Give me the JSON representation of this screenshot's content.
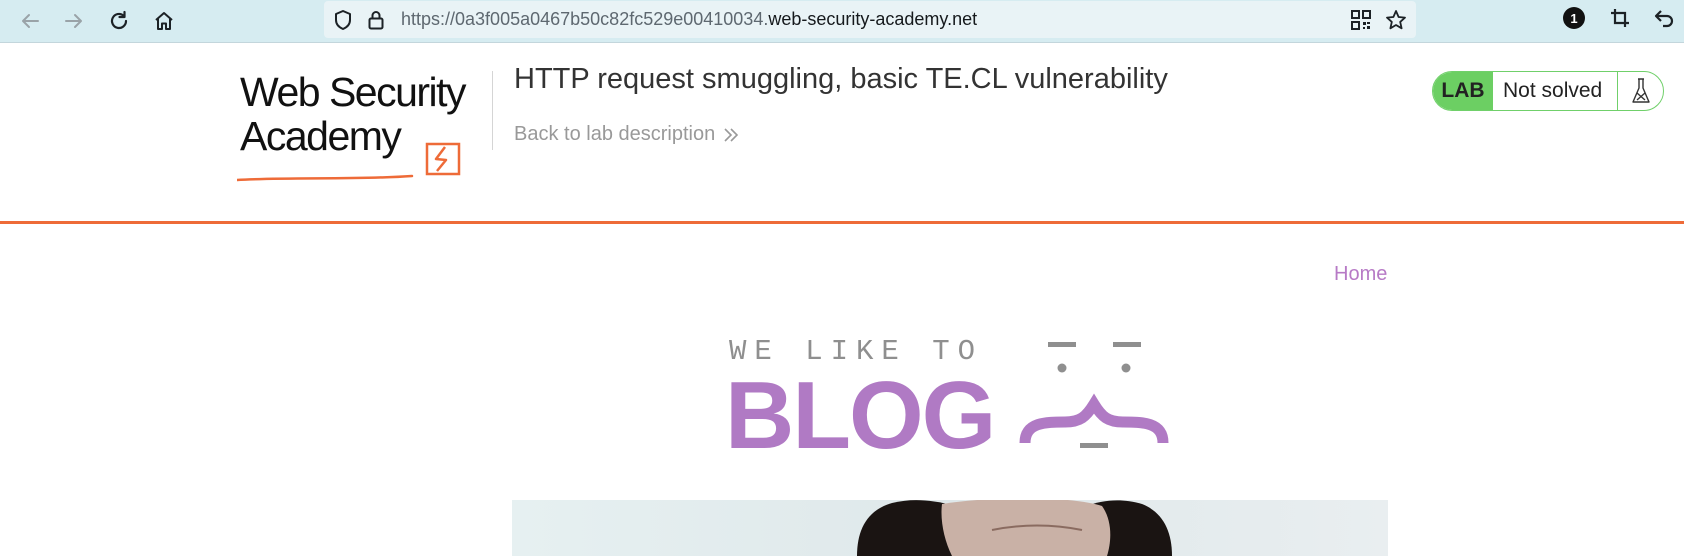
{
  "browser": {
    "back_icon": "arrow-left-icon",
    "forward_icon": "arrow-right-icon",
    "reload_icon": "reload-icon",
    "home_icon": "home-icon",
    "url_prefix": "https://0a3f005a0467b50c82fc529e00410034.",
    "url_domain": "web-security-academy.net",
    "notification_count": "1",
    "colors": {
      "bar": "#d6ecf1",
      "url_box": "#e9f3f6"
    }
  },
  "lab": {
    "logo_line1": "Web Security",
    "logo_line2": "Academy",
    "title": "HTTP request smuggling, basic TE.CL vulnerability",
    "back_link": "Back to lab description",
    "badge": "LAB",
    "status": "Not solved",
    "colors": {
      "accent": "#ee6b38",
      "badge": "#6ccf63"
    }
  },
  "site": {
    "nav_home": "Home",
    "banner_top": "WE LIKE TO",
    "banner_main": "BLOG",
    "colors": {
      "link": "#b77ac6",
      "blog": "#b07ac4",
      "grey": "#8f8f8f"
    }
  }
}
